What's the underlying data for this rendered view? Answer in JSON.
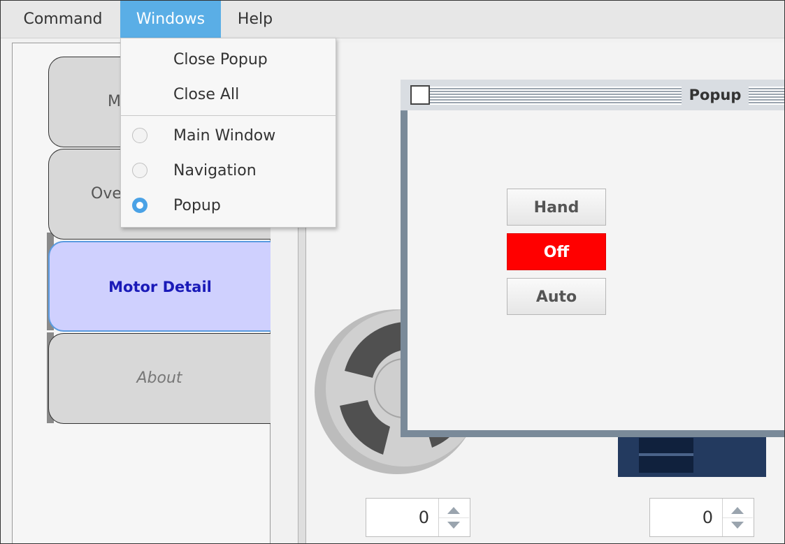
{
  "menubar": {
    "items": [
      {
        "label": "Command"
      },
      {
        "label": "Windows"
      },
      {
        "label": "Help"
      }
    ]
  },
  "windows_menu": {
    "close_items": [
      {
        "label": "Close Popup"
      },
      {
        "label": "Close All"
      }
    ],
    "window_items": [
      {
        "label": "Main Window",
        "selected": false
      },
      {
        "label": "Navigation",
        "selected": false
      },
      {
        "label": "Popup",
        "selected": true
      }
    ]
  },
  "navigation": {
    "buttons": [
      {
        "label": "M"
      },
      {
        "label": "Ove"
      },
      {
        "label": "Motor Detail",
        "selected": true
      },
      {
        "label": "About"
      }
    ]
  },
  "popup": {
    "title": "Popup",
    "buttons": [
      {
        "label": "Hand"
      },
      {
        "label": "Off",
        "active": true,
        "color": "#ff0000"
      },
      {
        "label": "Auto"
      }
    ]
  },
  "spinners": [
    {
      "value": "0"
    },
    {
      "value": "0"
    }
  ],
  "colors": {
    "menu_active": "#5aaee6",
    "selected_nav": "#cfd0fe",
    "off_button": "#ff0000"
  }
}
